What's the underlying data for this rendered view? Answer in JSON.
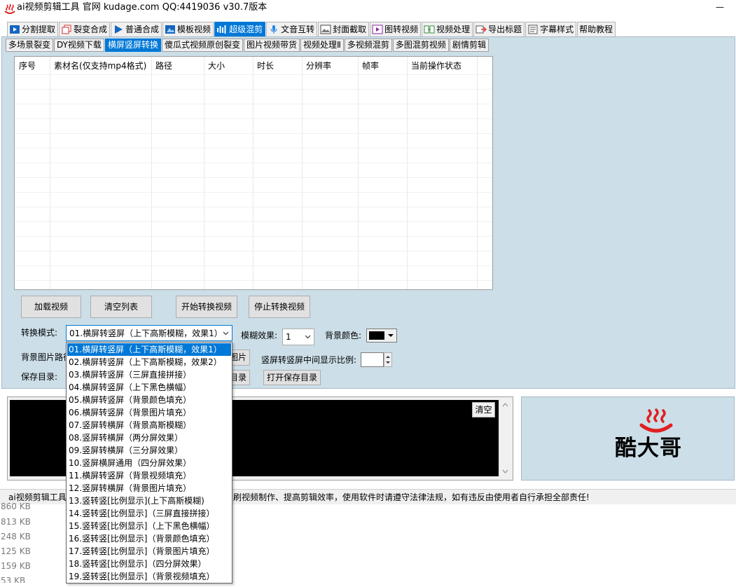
{
  "window": {
    "title": "ai视频剪辑工具 官网 kudage.com QQ:4419036   v30.7版本",
    "minimize_glyph": "—"
  },
  "main_tabs": [
    {
      "label": "分割提取",
      "icon": "film-split-icon",
      "color": "#1565c0"
    },
    {
      "label": "裂变合成",
      "icon": "copy-pages-icon",
      "color": "#d32f2f"
    },
    {
      "label": "普通合成",
      "icon": "play-icon",
      "color": "#1565c0"
    },
    {
      "label": "模板视频",
      "icon": "template-icon",
      "color": "#1565c0"
    },
    {
      "label": "超级混剪",
      "icon": "audio-bars-icon",
      "color": "#ffffff",
      "active": true
    },
    {
      "label": "文音互转",
      "icon": "microphone-icon",
      "color": "#1e88e5"
    },
    {
      "label": "封面截取",
      "icon": "image-icon",
      "color": "#444444"
    },
    {
      "label": "图转视频",
      "icon": "image-to-video-icon",
      "color": "#8e24aa"
    },
    {
      "label": "视频处理",
      "icon": "video-process-icon",
      "color": "#388e3c"
    },
    {
      "label": "导出标题",
      "icon": "export-icon",
      "color": "#e53935"
    },
    {
      "label": "字幕样式",
      "icon": "subtitle-icon",
      "color": "#555555"
    },
    {
      "label": "帮助教程",
      "icon": "",
      "color": "#000000"
    }
  ],
  "sub_tabs": [
    {
      "label": "多场景裂变"
    },
    {
      "label": "DY视频下载"
    },
    {
      "label": "横屏竖屏转换",
      "active": true
    },
    {
      "label": "傻瓜式视频原创裂变"
    },
    {
      "label": "图片视频带货"
    },
    {
      "label": "视频处理Ⅱ"
    },
    {
      "label": "多视频混剪"
    },
    {
      "label": "多图混剪视频"
    },
    {
      "label": "剧情剪辑"
    }
  ],
  "table": {
    "columns": [
      "序号",
      "素材名(仅支持mp4格式)",
      "路径",
      "大小",
      "时长",
      "分辨率",
      "帧率",
      "当前操作状态"
    ]
  },
  "buttons": {
    "load_video": "加载视频",
    "clear_list": "清空列表",
    "start_convert": "开始转换视频",
    "stop_convert": "停止转换视频",
    "pick_image": "图片",
    "pick_dir": "目录",
    "open_save_dir": "打开保存目录",
    "clear_log": "清空"
  },
  "form": {
    "mode_label": "转换模式:",
    "mode_value": "01.横屏转竖屏（上下高斯模糊，效果1）",
    "blur_label": "模糊效果:",
    "blur_value": "1",
    "bg_color_label": "背景颜色:",
    "bg_color": "#000000",
    "bg_image_label": "背景图片路径",
    "ratio_label": "竖屏转竖屏中间显示比例:",
    "save_dir_label": "保存目录:"
  },
  "mode_options": [
    "01.横屏转竖屏（上下高斯模糊，效果1）",
    "02.横屏转竖屏（上下高斯模糊，效果2）",
    "03.横屏转竖屏（三屏直接拼接）",
    "04.横屏转竖屏（上下黑色横幅）",
    "05.横屏转竖屏（背景颜色填充）",
    "06.横屏转竖屏（背景图片填充）",
    "07.竖屏转横屏（背景高斯模糊）",
    "08.竖屏转横屏（两分屏效果）",
    "09.竖屏转横屏（三分屏效果）",
    "10.竖屏横屏通用（四分屏效果）",
    "11.横屏转竖屏（背景视频填充）",
    "12.竖屏转横屏（背景图片填充）",
    "13.竖转竖[比例显示](上下高斯模糊)",
    "14.竖转竖[比例显示]（三屏直接拼接）",
    "15.竖转竖[比例显示]（上下黑色横幅）",
    "16.竖转竖[比例显示]（背景颜色填充）",
    "17.竖转竖[比例显示]（背景图片填充）",
    "18.竖转竖[比例显示]（四分屏效果）",
    "19.竖转竖[比例显示]（背景视频填充）"
  ],
  "logo": {
    "text": "酷大哥",
    "color": "#e02020"
  },
  "status": {
    "left": "ai视频剪辑工具",
    "right": "刷视频制作、提高剪辑效率，使用软件时请遵守法律法规，如有违反由使用者自行承担全部责任!"
  },
  "background_list": {
    "sizes": [
      "860 KB",
      "813 KB",
      "248 KB",
      "125 KB",
      "159 KB",
      "53 KB"
    ]
  }
}
